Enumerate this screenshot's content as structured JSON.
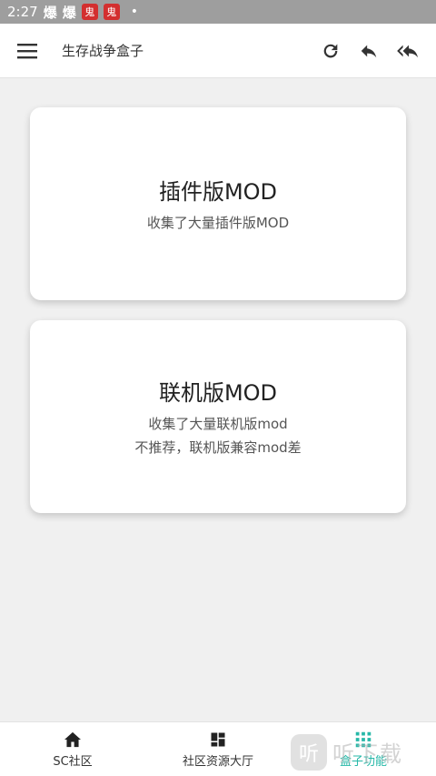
{
  "status_bar": {
    "time": "2:27",
    "glyph_1": "爆",
    "glyph_2": "爆",
    "badge_1": "鬼",
    "badge_2": "鬼",
    "dot": "•"
  },
  "app_bar": {
    "menu_icon": "hamburger-menu-icon",
    "title": "生存战争盒子",
    "actions": [
      "refresh-icon",
      "reply-icon",
      "reply-all-icon"
    ]
  },
  "cards": [
    {
      "title": "插件版MOD",
      "lines": [
        "收集了大量插件版MOD"
      ]
    },
    {
      "title": "联机版MOD",
      "lines": [
        "收集了大量联机版mod",
        "不推荐，联机版兼容mod差"
      ]
    }
  ],
  "bottom_nav": {
    "items": [
      {
        "label": "SC社区",
        "icon": "home-icon"
      },
      {
        "label": "社区资源大厅",
        "icon": "dashboard-icon"
      },
      {
        "label": "盒子功能",
        "icon": "apps-grid-icon",
        "active": true
      }
    ],
    "active_color": "#26b8a8"
  },
  "watermark": {
    "logo_char": "听",
    "text": "听下载"
  },
  "colors": {
    "background": "#f0f0f0",
    "status_bar": "#9e9e9e",
    "accent": "#26b8a8"
  }
}
